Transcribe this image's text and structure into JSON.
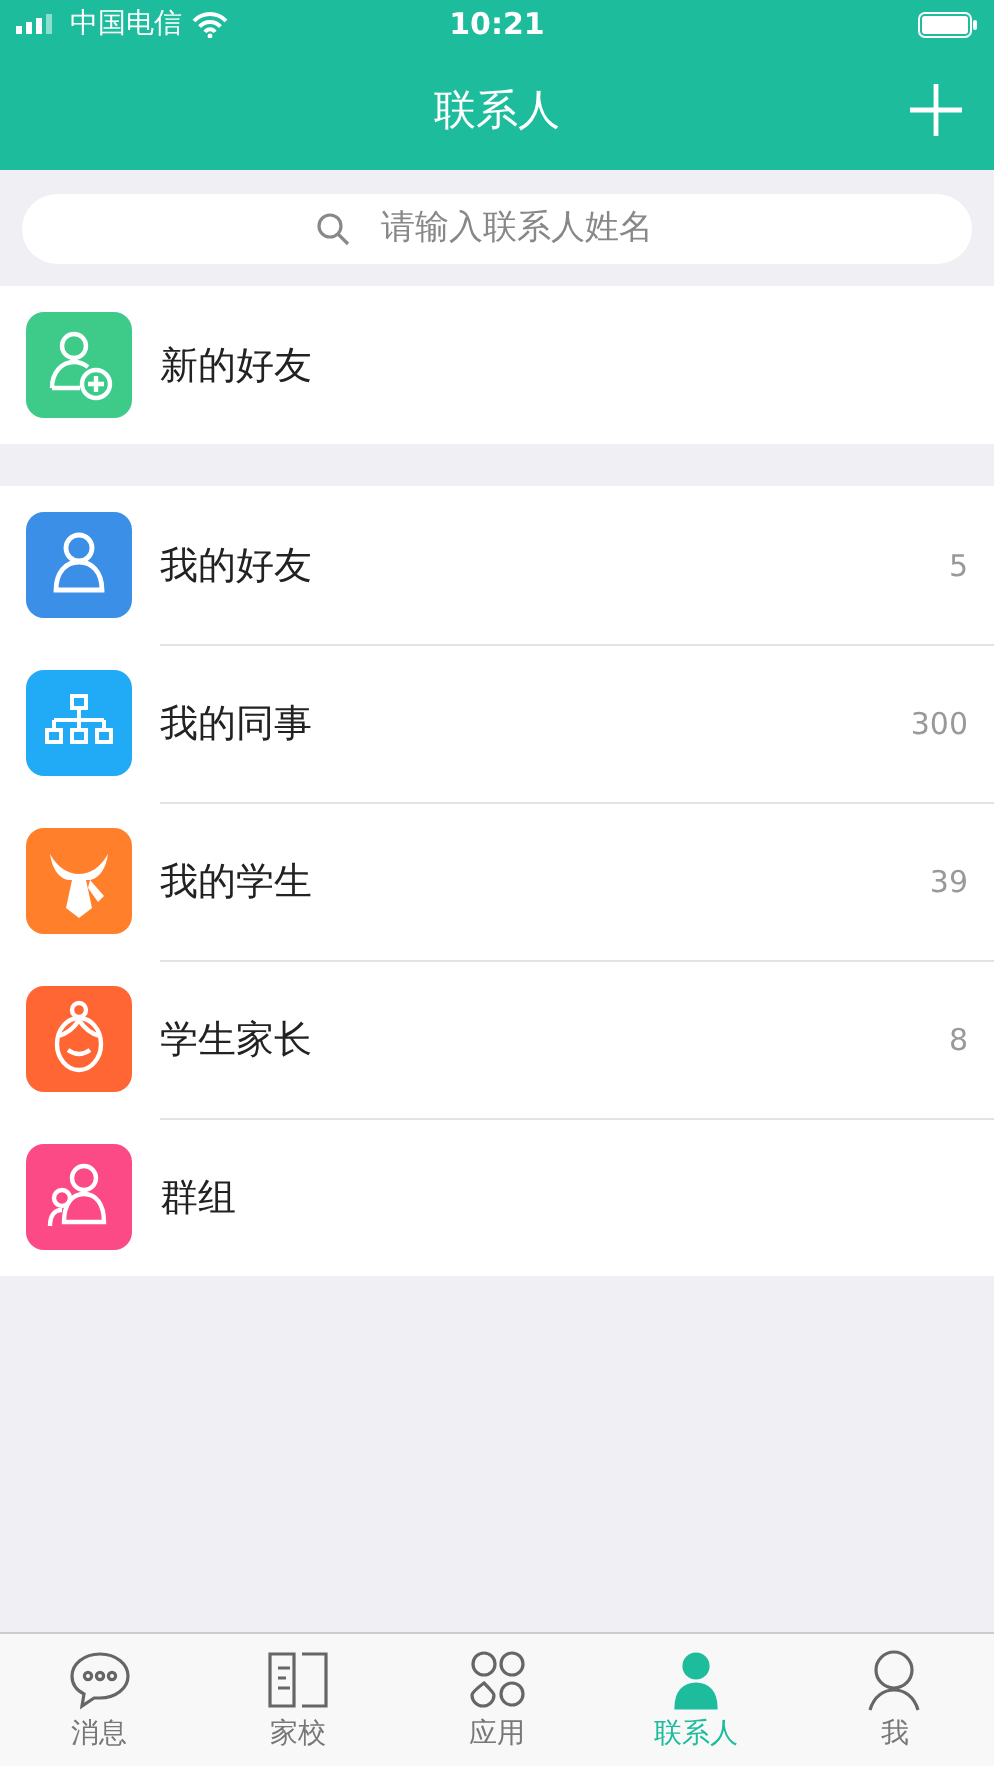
{
  "status_bar": {
    "carrier": "中国电信",
    "time": "10:21"
  },
  "header": {
    "title": "联系人"
  },
  "search": {
    "placeholder": "请输入联系人姓名"
  },
  "sections": [
    {
      "rows": [
        {
          "kind": "add-person",
          "color": "#3ecb8a",
          "label": "新的好友"
        }
      ]
    },
    {
      "rows": [
        {
          "kind": "person",
          "color": "#3b8fe6",
          "label": "我的好友",
          "count": "5"
        },
        {
          "kind": "org",
          "color": "#21aaf5",
          "label": "我的同事",
          "count": "300"
        },
        {
          "kind": "tie",
          "color": "#ff7f2a",
          "label": "我的学生",
          "count": "39"
        },
        {
          "kind": "face",
          "color": "#ff6634",
          "label": "学生家长",
          "count": "8"
        },
        {
          "kind": "group",
          "color": "#fb4a86",
          "label": "群组"
        }
      ]
    }
  ],
  "tabs": [
    {
      "kind": "chat",
      "label": "消息",
      "selected": false
    },
    {
      "kind": "book",
      "label": "家校",
      "selected": false
    },
    {
      "kind": "apps",
      "label": "应用",
      "selected": false
    },
    {
      "kind": "contacts",
      "label": "联系人",
      "selected": true
    },
    {
      "kind": "me",
      "label": "我",
      "selected": false
    }
  ]
}
